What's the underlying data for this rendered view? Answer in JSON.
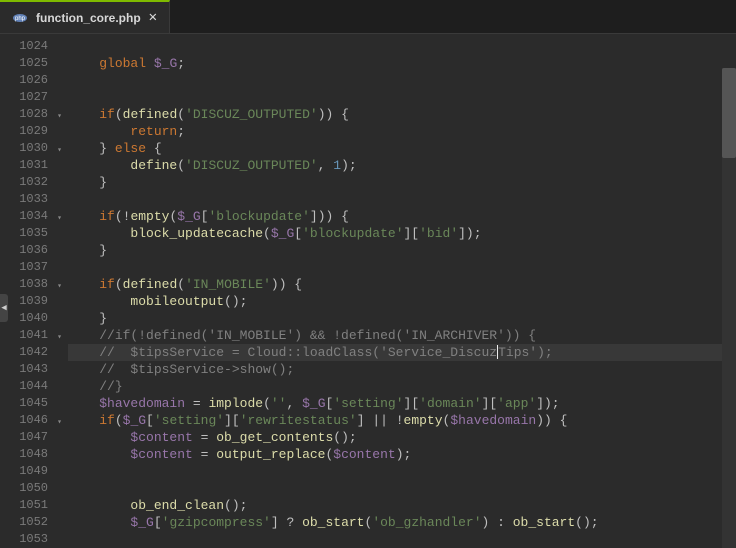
{
  "tab": {
    "filename": "function_core.php"
  },
  "startLine": 1024,
  "currentLine": 1042,
  "foldLines": [
    1028,
    1030,
    1034,
    1038,
    1041,
    1046
  ],
  "lines": [
    [],
    [
      {
        "c": "txt",
        "t": "    "
      },
      {
        "c": "kw",
        "t": "global"
      },
      {
        "c": "txt",
        "t": " "
      },
      {
        "c": "var",
        "t": "$_G"
      },
      {
        "c": "txt",
        "t": ";"
      }
    ],
    [],
    [],
    [
      {
        "c": "txt",
        "t": "    "
      },
      {
        "c": "kw",
        "t": "if"
      },
      {
        "c": "txt",
        "t": "("
      },
      {
        "c": "fn",
        "t": "defined"
      },
      {
        "c": "txt",
        "t": "("
      },
      {
        "c": "str",
        "t": "'DISCUZ_OUTPUTED'"
      },
      {
        "c": "txt",
        "t": ")) {"
      }
    ],
    [
      {
        "c": "txt",
        "t": "        "
      },
      {
        "c": "kw",
        "t": "return"
      },
      {
        "c": "txt",
        "t": ";"
      }
    ],
    [
      {
        "c": "txt",
        "t": "    } "
      },
      {
        "c": "kw",
        "t": "else"
      },
      {
        "c": "txt",
        "t": " {"
      }
    ],
    [
      {
        "c": "txt",
        "t": "        "
      },
      {
        "c": "fn",
        "t": "define"
      },
      {
        "c": "txt",
        "t": "("
      },
      {
        "c": "str",
        "t": "'DISCUZ_OUTPUTED'"
      },
      {
        "c": "txt",
        "t": ", "
      },
      {
        "c": "num",
        "t": "1"
      },
      {
        "c": "txt",
        "t": ");"
      }
    ],
    [
      {
        "c": "txt",
        "t": "    }"
      }
    ],
    [],
    [
      {
        "c": "txt",
        "t": "    "
      },
      {
        "c": "kw",
        "t": "if"
      },
      {
        "c": "txt",
        "t": "(!"
      },
      {
        "c": "fn",
        "t": "empty"
      },
      {
        "c": "txt",
        "t": "("
      },
      {
        "c": "var",
        "t": "$_G"
      },
      {
        "c": "txt",
        "t": "["
      },
      {
        "c": "str",
        "t": "'blockupdate'"
      },
      {
        "c": "txt",
        "t": "])) {"
      }
    ],
    [
      {
        "c": "txt",
        "t": "        "
      },
      {
        "c": "fn",
        "t": "block_updatecache"
      },
      {
        "c": "txt",
        "t": "("
      },
      {
        "c": "var",
        "t": "$_G"
      },
      {
        "c": "txt",
        "t": "["
      },
      {
        "c": "str",
        "t": "'blockupdate'"
      },
      {
        "c": "txt",
        "t": "]["
      },
      {
        "c": "str",
        "t": "'bid'"
      },
      {
        "c": "txt",
        "t": "]);"
      }
    ],
    [
      {
        "c": "txt",
        "t": "    }"
      }
    ],
    [],
    [
      {
        "c": "txt",
        "t": "    "
      },
      {
        "c": "kw",
        "t": "if"
      },
      {
        "c": "txt",
        "t": "("
      },
      {
        "c": "fn",
        "t": "defined"
      },
      {
        "c": "txt",
        "t": "("
      },
      {
        "c": "str",
        "t": "'IN_MOBILE'"
      },
      {
        "c": "txt",
        "t": ")) {"
      }
    ],
    [
      {
        "c": "txt",
        "t": "        "
      },
      {
        "c": "fn",
        "t": "mobileoutput"
      },
      {
        "c": "txt",
        "t": "();"
      }
    ],
    [
      {
        "c": "txt",
        "t": "    }"
      }
    ],
    [
      {
        "c": "txt",
        "t": "    "
      },
      {
        "c": "com",
        "t": "//if(!defined('IN_MOBILE') && !defined('IN_ARCHIVER')) {"
      }
    ],
    [
      {
        "c": "txt",
        "t": "    "
      },
      {
        "c": "com",
        "t": "//  $tipsService = Cloud::loadClass('Service_Discuz"
      },
      {
        "c": "cursor",
        "t": ""
      },
      {
        "c": "com",
        "t": "Tips');"
      }
    ],
    [
      {
        "c": "txt",
        "t": "    "
      },
      {
        "c": "com",
        "t": "//  $tipsService->show();"
      }
    ],
    [
      {
        "c": "txt",
        "t": "    "
      },
      {
        "c": "com",
        "t": "//}"
      }
    ],
    [
      {
        "c": "txt",
        "t": "    "
      },
      {
        "c": "var",
        "t": "$havedomain"
      },
      {
        "c": "txt",
        "t": " = "
      },
      {
        "c": "fn",
        "t": "implode"
      },
      {
        "c": "txt",
        "t": "("
      },
      {
        "c": "str",
        "t": "''"
      },
      {
        "c": "txt",
        "t": ", "
      },
      {
        "c": "var",
        "t": "$_G"
      },
      {
        "c": "txt",
        "t": "["
      },
      {
        "c": "str",
        "t": "'setting'"
      },
      {
        "c": "txt",
        "t": "]["
      },
      {
        "c": "str",
        "t": "'domain'"
      },
      {
        "c": "txt",
        "t": "]["
      },
      {
        "c": "str",
        "t": "'app'"
      },
      {
        "c": "txt",
        "t": "]);"
      }
    ],
    [
      {
        "c": "txt",
        "t": "    "
      },
      {
        "c": "kw",
        "t": "if"
      },
      {
        "c": "txt",
        "t": "("
      },
      {
        "c": "var",
        "t": "$_G"
      },
      {
        "c": "txt",
        "t": "["
      },
      {
        "c": "str",
        "t": "'setting'"
      },
      {
        "c": "txt",
        "t": "]["
      },
      {
        "c": "str",
        "t": "'rewritestatus'"
      },
      {
        "c": "txt",
        "t": "] || !"
      },
      {
        "c": "fn",
        "t": "empty"
      },
      {
        "c": "txt",
        "t": "("
      },
      {
        "c": "var",
        "t": "$havedomain"
      },
      {
        "c": "txt",
        "t": ")) {"
      }
    ],
    [
      {
        "c": "txt",
        "t": "        "
      },
      {
        "c": "var",
        "t": "$content"
      },
      {
        "c": "txt",
        "t": " = "
      },
      {
        "c": "fn",
        "t": "ob_get_contents"
      },
      {
        "c": "txt",
        "t": "();"
      }
    ],
    [
      {
        "c": "txt",
        "t": "        "
      },
      {
        "c": "var",
        "t": "$content"
      },
      {
        "c": "txt",
        "t": " = "
      },
      {
        "c": "fn",
        "t": "output_replace"
      },
      {
        "c": "txt",
        "t": "("
      },
      {
        "c": "var",
        "t": "$content"
      },
      {
        "c": "txt",
        "t": ");"
      }
    ],
    [],
    [],
    [
      {
        "c": "txt",
        "t": "        "
      },
      {
        "c": "fn",
        "t": "ob_end_clean"
      },
      {
        "c": "txt",
        "t": "();"
      }
    ],
    [
      {
        "c": "txt",
        "t": "        "
      },
      {
        "c": "var",
        "t": "$_G"
      },
      {
        "c": "txt",
        "t": "["
      },
      {
        "c": "str",
        "t": "'gzipcompress'"
      },
      {
        "c": "txt",
        "t": "] ? "
      },
      {
        "c": "fn",
        "t": "ob_start"
      },
      {
        "c": "txt",
        "t": "("
      },
      {
        "c": "str",
        "t": "'ob_gzhandler'"
      },
      {
        "c": "txt",
        "t": ") : "
      },
      {
        "c": "fn",
        "t": "ob_start"
      },
      {
        "c": "txt",
        "t": "();"
      }
    ],
    []
  ]
}
